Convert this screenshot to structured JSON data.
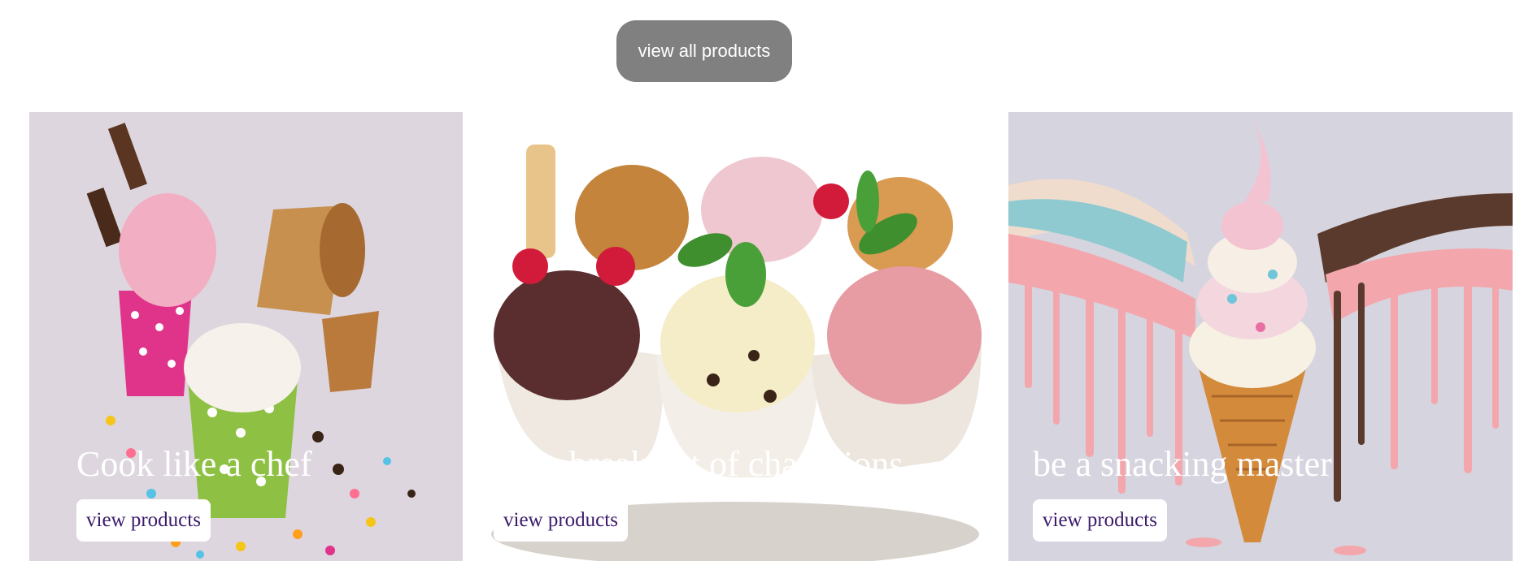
{
  "header": {
    "view_all_label": "view all products"
  },
  "cards": [
    {
      "title": "Cook like a chef",
      "button_label": "view products",
      "image": "ice-cream-cups-image"
    },
    {
      "title": "for a breakfast of champions",
      "button_label": "view products",
      "image": "ice-cream-bowls-image"
    },
    {
      "title": "be a snacking master",
      "button_label": "view products",
      "image": "ice-cream-cone-image"
    }
  ]
}
